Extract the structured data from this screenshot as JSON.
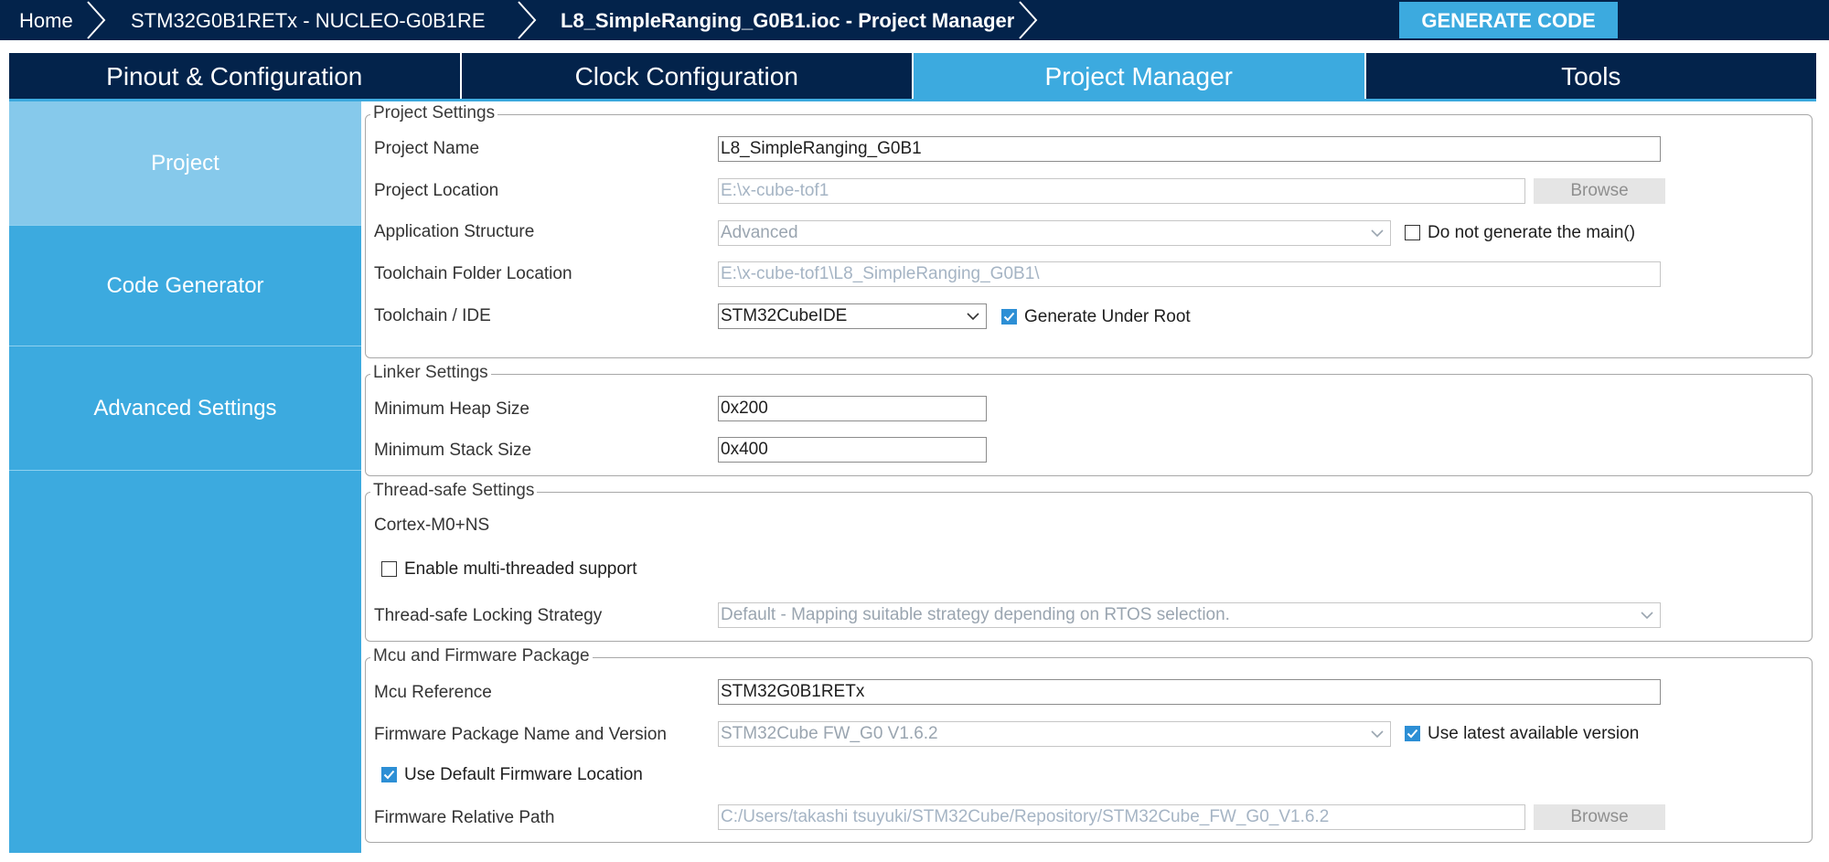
{
  "breadcrumb": {
    "home": "Home",
    "device": "STM32G0B1RETx  -  NUCLEO-G0B1RE",
    "file": "L8_SimpleRanging_G0B1.ioc - Project Manager"
  },
  "toolbar": {
    "generate_label": "GENERATE CODE"
  },
  "tabs": [
    {
      "label": "Pinout & Configuration"
    },
    {
      "label": "Clock Configuration"
    },
    {
      "label": "Project Manager"
    },
    {
      "label": "Tools"
    }
  ],
  "sidebar": {
    "items": [
      {
        "label": "Project"
      },
      {
        "label": "Code Generator"
      },
      {
        "label": "Advanced Settings"
      }
    ]
  },
  "project_settings": {
    "legend": "Project Settings",
    "project_name_label": "Project Name",
    "project_name_value": "L8_SimpleRanging_G0B1",
    "project_location_label": "Project Location",
    "project_location_value": "E:\\x-cube-tof1",
    "browse_label": "Browse",
    "app_structure_label": "Application Structure",
    "app_structure_value": "Advanced",
    "do_not_generate_main_label": "Do not generate the main()",
    "do_not_generate_main_checked": false,
    "toolchain_folder_label": "Toolchain Folder Location",
    "toolchain_folder_value": "E:\\x-cube-tof1\\L8_SimpleRanging_G0B1\\",
    "toolchain_ide_label": "Toolchain / IDE",
    "toolchain_ide_value": "STM32CubeIDE",
    "generate_under_root_label": "Generate Under Root",
    "generate_under_root_checked": true
  },
  "linker_settings": {
    "legend": "Linker Settings",
    "heap_label": "Minimum Heap Size",
    "heap_value": "0x200",
    "stack_label": "Minimum Stack Size",
    "stack_value": "0x400"
  },
  "thread_safe": {
    "legend": "Thread-safe Settings",
    "core_label": "Cortex-M0+NS",
    "multithread_label": "Enable multi-threaded support",
    "multithread_checked": false,
    "strategy_label": "Thread-safe Locking Strategy",
    "strategy_value": "Default  -  Mapping suitable strategy depending on RTOS selection."
  },
  "mcu_firmware": {
    "legend": "Mcu and Firmware Package",
    "mcu_ref_label": "Mcu Reference",
    "mcu_ref_value": "STM32G0B1RETx",
    "fw_name_label": "Firmware Package Name and Version",
    "fw_name_value": "STM32Cube FW_G0 V1.6.2",
    "use_latest_label": "Use latest available version",
    "use_latest_checked": true,
    "use_default_loc_label": "Use Default Firmware Location",
    "use_default_loc_checked": true,
    "fw_path_label": "Firmware Relative Path",
    "fw_path_value": "C:/Users/takashi tsuyuki/STM32Cube/Repository/STM32Cube_FW_G0_V1.6.2",
    "browse_label": "Browse"
  },
  "colors": {
    "navy": "#03234b",
    "accent": "#3caadf",
    "active_nav": "#86c9eb",
    "checkbox": "#2d8fd5"
  }
}
